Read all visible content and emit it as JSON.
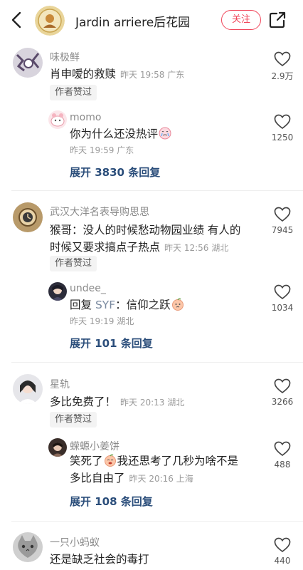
{
  "header": {
    "title": "Jardin arriere后花园",
    "follow_label": "关注"
  },
  "comments": [
    {
      "username": "味极鲜",
      "text": "肖申嗳的救赎",
      "meta": "昨天 19:58 广东",
      "badge": "作者赞过",
      "likes": "2.9万",
      "reply": {
        "username": "momo",
        "text": "你为什么还没热评",
        "meta": "昨天 19:59 广东",
        "likes": "1250"
      },
      "expand": "展开 3830 条回复"
    },
    {
      "username": "武汉大洋名表导购思思",
      "text_line1": "猴哥：没人的时候愁动物园业绩 有人的",
      "text_line2": "时候又要求搞点子热点",
      "meta": "昨天 12:56 湖北",
      "badge": "作者赞过",
      "likes": "7945",
      "reply": {
        "username": "undee_",
        "text_prefix": "回复 ",
        "reply_to": "SYF",
        "text": "：信仰之跃",
        "meta": "昨天 19:19 湖北",
        "likes": "1034"
      },
      "expand": "展开 101 条回复"
    },
    {
      "username": "星轨",
      "text": "多比免费了！",
      "meta": "昨天 20:13 湖北",
      "badge": "作者赞过",
      "likes": "3266",
      "reply": {
        "username": "蝾螈小姜饼",
        "text_line1_a": "笑死了",
        "text_line1_b": "我还思考了几秒为啥不是",
        "text_line2": "多比自由了",
        "meta": "昨天 20:16 上海",
        "likes": "488"
      },
      "expand": "展开 108 条回复"
    },
    {
      "username": "一只小蚂蚁",
      "text": "还是缺乏社会的毒打",
      "likes": "440"
    }
  ],
  "colors": {
    "accent": "#f0465a",
    "expand": "#2a4d7a",
    "secondary_text": "#8a8a8a"
  },
  "icons": [
    "back-arrow-icon",
    "share-icon",
    "heart-icon",
    "crying-face-icon",
    "peach-face-icon"
  ]
}
